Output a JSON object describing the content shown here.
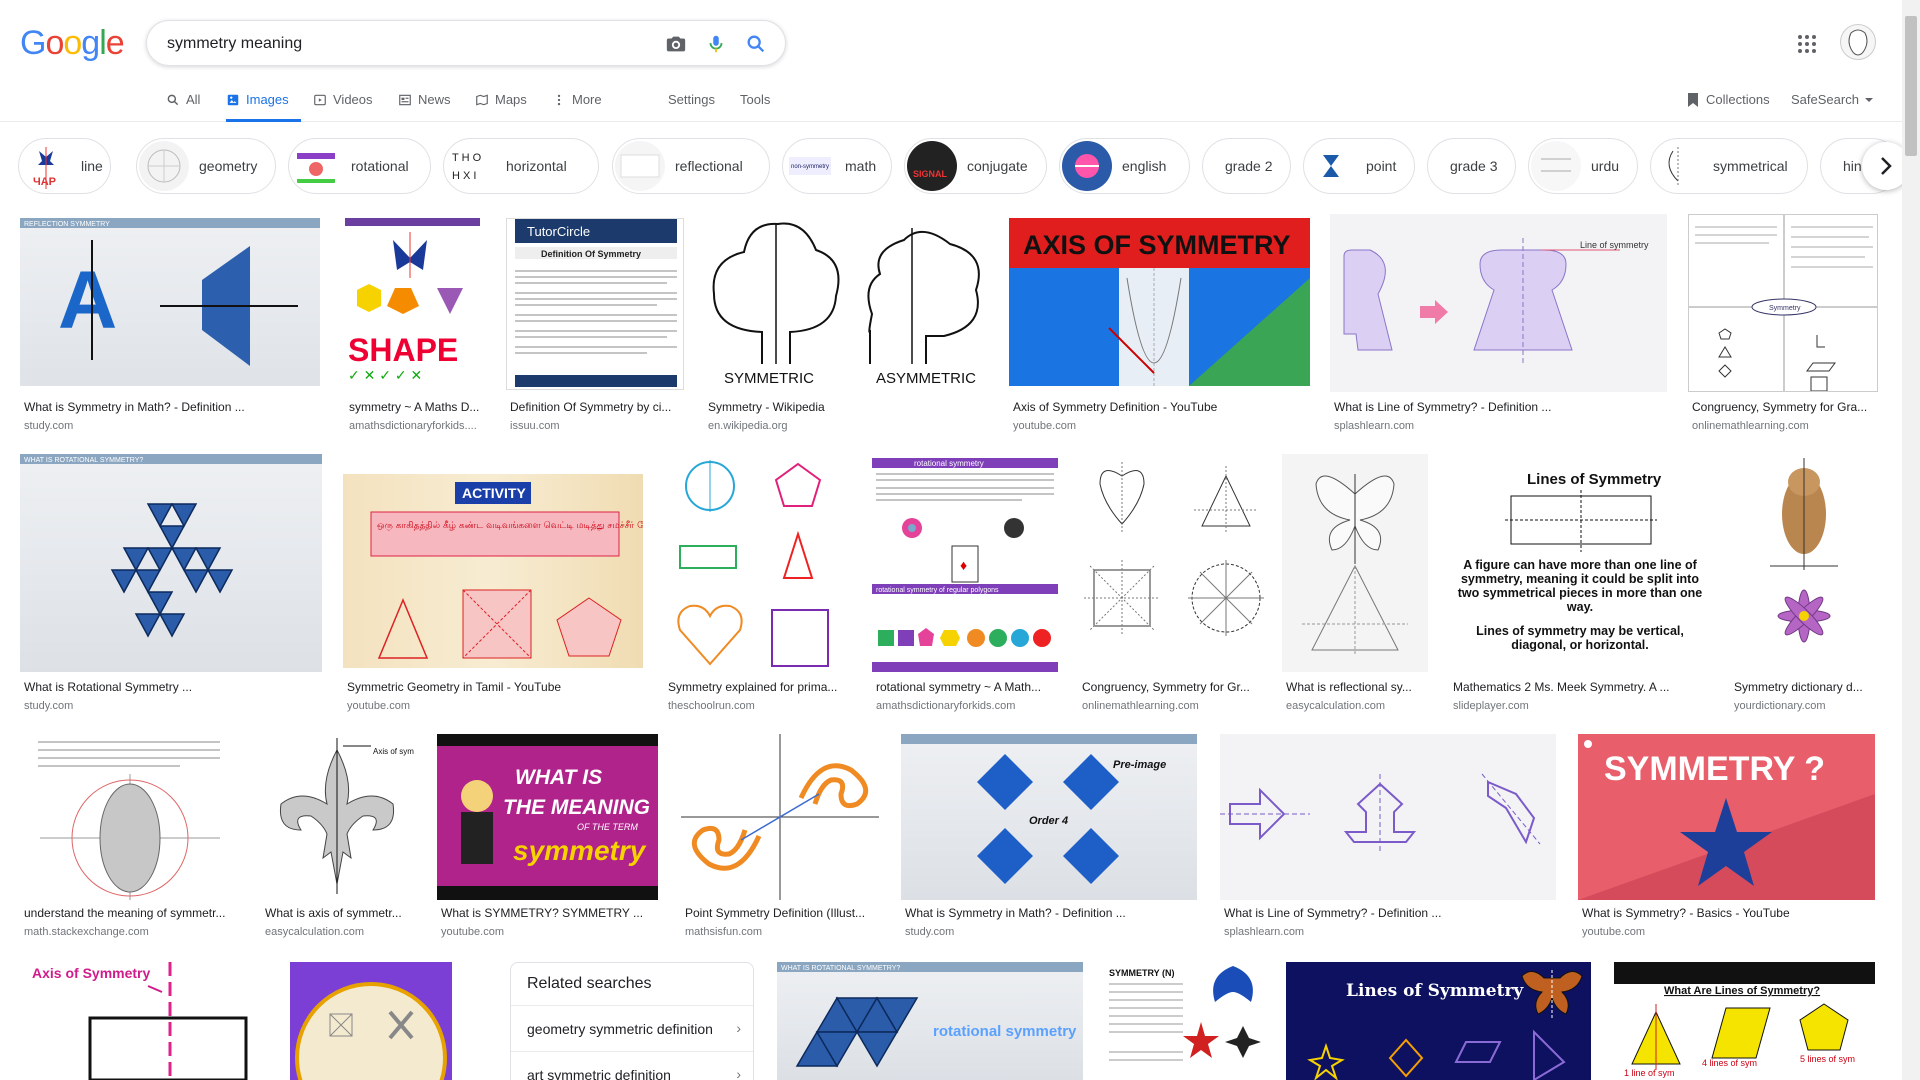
{
  "logo": {
    "text": "Google"
  },
  "search": {
    "query": "symmetry meaning"
  },
  "nav": {
    "tabs": [
      {
        "label": "All",
        "icon": "search-icon"
      },
      {
        "label": "Images",
        "icon": "image-icon"
      },
      {
        "label": "Videos",
        "icon": "video-icon"
      },
      {
        "label": "News",
        "icon": "news-icon"
      },
      {
        "label": "Maps",
        "icon": "map-icon"
      },
      {
        "label": "More",
        "icon": "more-vert-icon"
      }
    ],
    "settings": "Settings",
    "tools": "Tools",
    "collections": "Collections",
    "safesearch": "SafeSearch"
  },
  "chips": [
    "line",
    "geometry",
    "rotational",
    "horizontal",
    "reflectional",
    "math",
    "conjugate",
    "english",
    "grade 2",
    "point",
    "grade 3",
    "urdu",
    "symmetrical",
    "hindi"
  ],
  "rows": [
    [
      {
        "caption": "What is Symmetry in Math? - Definition ...",
        "source": "study.com"
      },
      {
        "caption": "symmetry ~ A Maths D...",
        "source": "amathsdictionaryforkids...."
      },
      {
        "caption": "Definition Of Symmetry by ci...",
        "source": "issuu.com"
      },
      {
        "caption": "Symmetry - Wikipedia",
        "source": "en.wikipedia.org"
      },
      {
        "caption": "Axis of Symmetry Definition - YouTube",
        "source": "youtube.com"
      },
      {
        "caption": "What is Line of Symmetry? - Definition ...",
        "source": "splashlearn.com"
      },
      {
        "caption": "Congruency, Symmetry for Gra...",
        "source": "onlinemathlearning.com"
      }
    ],
    [
      {
        "caption": "What is Rotational Symmetry ...",
        "source": "study.com"
      },
      {
        "caption": "Symmetric Geometry in Tamil - YouTube",
        "source": "youtube.com"
      },
      {
        "caption": "Symmetry explained for prima...",
        "source": "theschoolrun.com"
      },
      {
        "caption": "rotational symmetry ~ A Math...",
        "source": "amathsdictionaryforkids.com"
      },
      {
        "caption": "Congruency, Symmetry for Gr...",
        "source": "onlinemathlearning.com"
      },
      {
        "caption": "What is reflectional sy...",
        "source": "easycalculation.com"
      },
      {
        "caption": "Mathematics 2 Ms. Meek Symmetry. A ...",
        "source": "slideplayer.com"
      },
      {
        "caption": "Symmetry dictionary d...",
        "source": "yourdictionary.com"
      }
    ],
    [
      {
        "caption": "understand the meaning of symmetr...",
        "source": "math.stackexchange.com"
      },
      {
        "caption": "What is axis of symmetr...",
        "source": "easycalculation.com"
      },
      {
        "caption": "What is SYMMETRY? SYMMETRY ...",
        "source": "youtube.com"
      },
      {
        "caption": "Point Symmetry Definition (Illust...",
        "source": "mathsisfun.com"
      },
      {
        "caption": "What is Symmetry in Math? - Definition ...",
        "source": "study.com"
      },
      {
        "caption": "What is Line of Symmetry? - Definition ...",
        "source": "splashlearn.com"
      },
      {
        "caption": "What is Symmetry? - Basics - YouTube",
        "source": "youtube.com"
      }
    ]
  ],
  "image_text": {
    "reflection_banner": "REFLECTION SYMMETRY",
    "letter_a": "A",
    "shape": "SHAPE",
    "tutorcircle": "TutorCircle",
    "def_of_symmetry": "Definition Of Symmetry",
    "symmetric": "SYMMETRIC",
    "asymmetric": "ASYMMETRIC",
    "axis_of_symmetry": "AXIS OF SYMMETRY",
    "line_of_symmetry": "Line of symmetry",
    "symmetry_label": "Symmetry",
    "rotational_banner": "WHAT IS ROTATIONAL SYMMETRY?",
    "activity": "ACTIVITY",
    "tamil": "ஒரு காகிதத்தில் கீழ் கண்ட வடிவங்களை வெட்டி மடித்து சமச்சீர் கோடுகளை கண்டு பிடிக்கவும்",
    "rot_sym_title": "rotational symmetry",
    "rot_sym_polygons": "rotational symmetry of regular polygons",
    "lines_of_symmetry": "Lines of Symmetry",
    "lines_para1": "A figure can have more than one line of symmetry, meaning it could be split into two symmetrical pieces in more than one way.",
    "lines_para2": "Lines of symmetry may be vertical, diagonal, or horizontal.",
    "axis_label": "Axis of symmetry",
    "what_is": "WHAT IS",
    "the_meaning": "THE MEANING",
    "of_the_term": "OF THE TERM",
    "symmetry_word": "symmetry",
    "pre_image": "Pre-image",
    "order4": "Order 4",
    "symmetry_q": "SYMMETRY ?",
    "axis_of_symmetry_small": "Axis of Symmetry",
    "rotational_symmetry_small": "rotational symmetry",
    "symmetry_n": "SYMMETRY (N)",
    "lines_of_symmetry_big": "Lines of Symmetry",
    "what_are_lines": "What Are Lines of Symmetry?",
    "one_line": "1 line of sym",
    "four_lines": "4 lines of sym",
    "five_lines": "5 lines of sym"
  },
  "related": {
    "title": "Related searches",
    "items": [
      "geometry symmetric definition",
      "art symmetric definition"
    ]
  },
  "colors": {
    "accent": "#1a73e8",
    "google_blue": "#4285f4",
    "google_red": "#ea4335",
    "google_yellow": "#fbbc05",
    "google_green": "#34a853"
  }
}
